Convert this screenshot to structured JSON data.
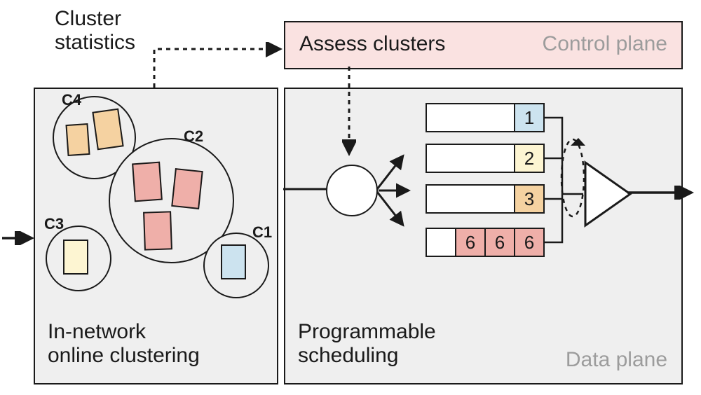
{
  "labels": {
    "cluster_stats_line1": "Cluster",
    "cluster_stats_line2": "statistics",
    "assess": "Assess clusters",
    "control_plane": "Control plane",
    "innet_line1": "In-network",
    "innet_line2": "online clustering",
    "progsched_line1": "Programmable",
    "progsched_line2": "scheduling",
    "data_plane": "Data plane"
  },
  "clusters": {
    "c1": "C1",
    "c2": "C2",
    "c3": "C3",
    "c4": "C4"
  },
  "queues": {
    "q1": "1",
    "q2": "2",
    "q3": "3",
    "q4a": "6",
    "q4b": "6",
    "q4c": "6"
  },
  "colors": {
    "blue": "#cce3ef",
    "yellow": "#fdf5d2",
    "orange": "#f5d2a1",
    "red": "#efafa9"
  }
}
